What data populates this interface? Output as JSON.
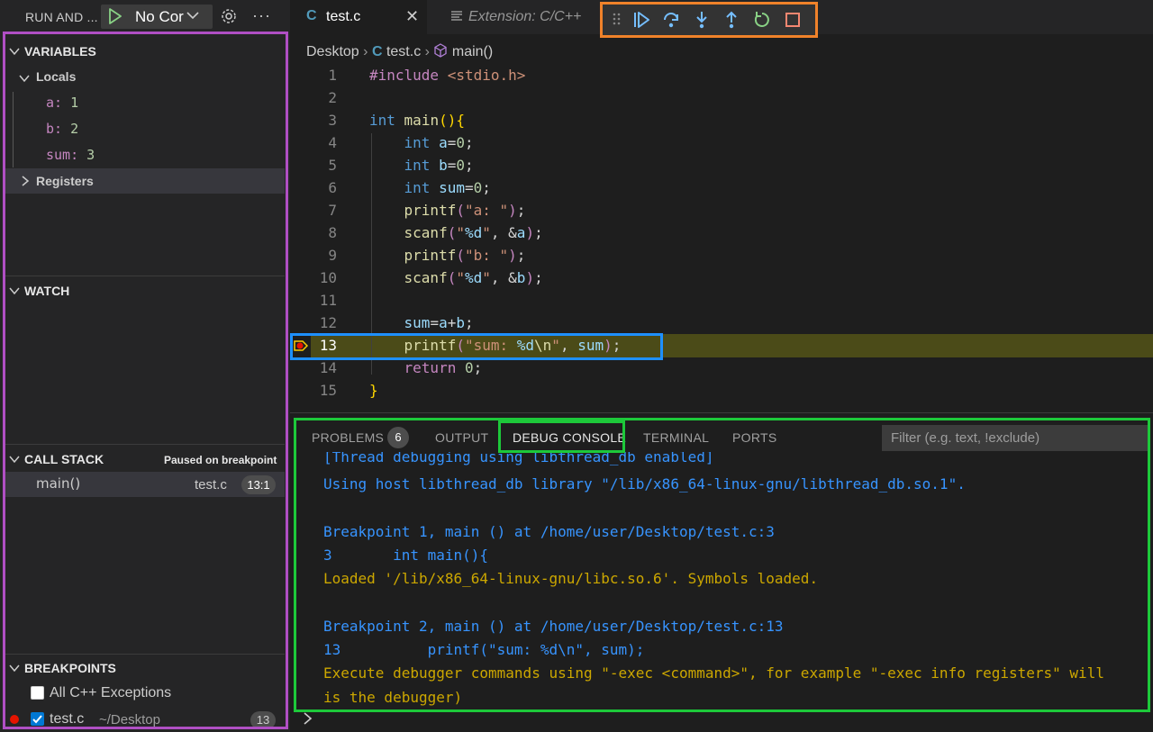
{
  "sidebar": {
    "run_title": "RUN AND ...",
    "config_name": "No Cor",
    "variables": {
      "title": "VARIABLES",
      "locals_label": "Locals",
      "locals": [
        {
          "name": "a:",
          "value": "1"
        },
        {
          "name": "b:",
          "value": "2"
        },
        {
          "name": "sum:",
          "value": "3"
        }
      ],
      "registers_label": "Registers"
    },
    "watch": {
      "title": "WATCH"
    },
    "call_stack": {
      "title": "CALL STACK",
      "status": "Paused on breakpoint",
      "frames": [
        {
          "name": "main()",
          "file": "test.c",
          "position": "13:1"
        }
      ]
    },
    "breakpoints": {
      "title": "BREAKPOINTS",
      "items": [
        {
          "label": "All C++ Exceptions",
          "checked": false
        },
        {
          "label": "test.c",
          "path": "~/Desktop",
          "line": "13",
          "checked": true
        }
      ]
    }
  },
  "tabs": [
    {
      "label": "test.c",
      "icon": "C",
      "active": true
    },
    {
      "label": "Extension: C/C++",
      "active": false
    }
  ],
  "breadcrumb": {
    "folder": "Desktop",
    "file": "test.c",
    "symbol": "main()"
  },
  "editor": {
    "current_line": 13,
    "line_numbers": [
      "1",
      "2",
      "3",
      "4",
      "5",
      "6",
      "7",
      "8",
      "9",
      "10",
      "11",
      "12",
      "13",
      "14",
      "15"
    ]
  },
  "panel": {
    "tabs": [
      "PROBLEMS",
      "OUTPUT",
      "DEBUG CONSOLE",
      "TERMINAL",
      "PORTS"
    ],
    "problems_count": "6",
    "active_tab": "DEBUG CONSOLE",
    "filter_placeholder": "Filter (e.g. text, !exclude)",
    "console_lines": [
      "[Thread debugging using libthread_db enabled]",
      "Using host libthread_db library \"/lib/x86_64-linux-gnu/libthread_db.so.1\".",
      "",
      "Breakpoint 1, main () at /home/user/Desktop/test.c:3",
      "3       int main(){",
      "Loaded '/lib/x86_64-linux-gnu/libc.so.6'. Symbols loaded.",
      "",
      "Breakpoint 2, main () at /home/user/Desktop/test.c:13",
      "13          printf(\"sum: %d\\n\", sum);",
      "Execute debugger commands using \"-exec <command>\", for example \"-exec info registers\" will",
      "is the debugger)"
    ],
    "prompt": ">"
  }
}
